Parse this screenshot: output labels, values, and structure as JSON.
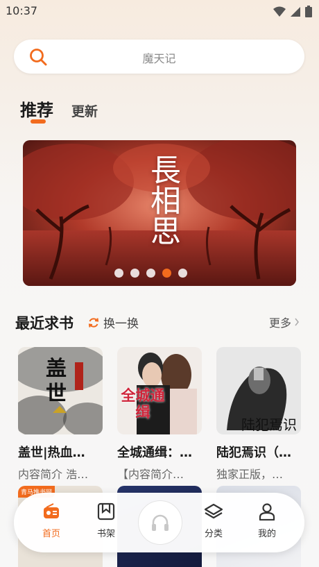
{
  "status_bar": {
    "time": "10:37"
  },
  "search": {
    "placeholder": "魔天记"
  },
  "tabs": [
    {
      "label": "推荐"
    },
    {
      "label": "更新"
    }
  ],
  "banner": {
    "title": "長相思",
    "dots": 5,
    "active_dot": 4
  },
  "section": {
    "title": "最近求书",
    "refresh_label": "换一换",
    "more_label": "更多"
  },
  "books": [
    {
      "title": "盖世|热血…",
      "desc": "内容简介 浩…",
      "cover_text": "盖世"
    },
    {
      "title": "全城通缉：…",
      "desc": "【内容简介…",
      "cover_text": "全城通缉"
    },
    {
      "title": "陆犯焉识（…",
      "desc": "独家正版，…",
      "cover_text": "陆犯焉识"
    }
  ],
  "second_row_badge": "青马推书网",
  "nav": [
    {
      "label": "首页",
      "icon": "radio-icon",
      "active": true
    },
    {
      "label": "书架",
      "icon": "bookmark-icon",
      "active": false
    },
    {
      "label": "",
      "icon": "headphones-icon",
      "active": false
    },
    {
      "label": "分类",
      "icon": "layers-icon",
      "active": false
    },
    {
      "label": "我的",
      "icon": "user-icon",
      "active": false
    }
  ],
  "colors": {
    "accent": "#f26b1d",
    "background": "#f7f7f7"
  }
}
